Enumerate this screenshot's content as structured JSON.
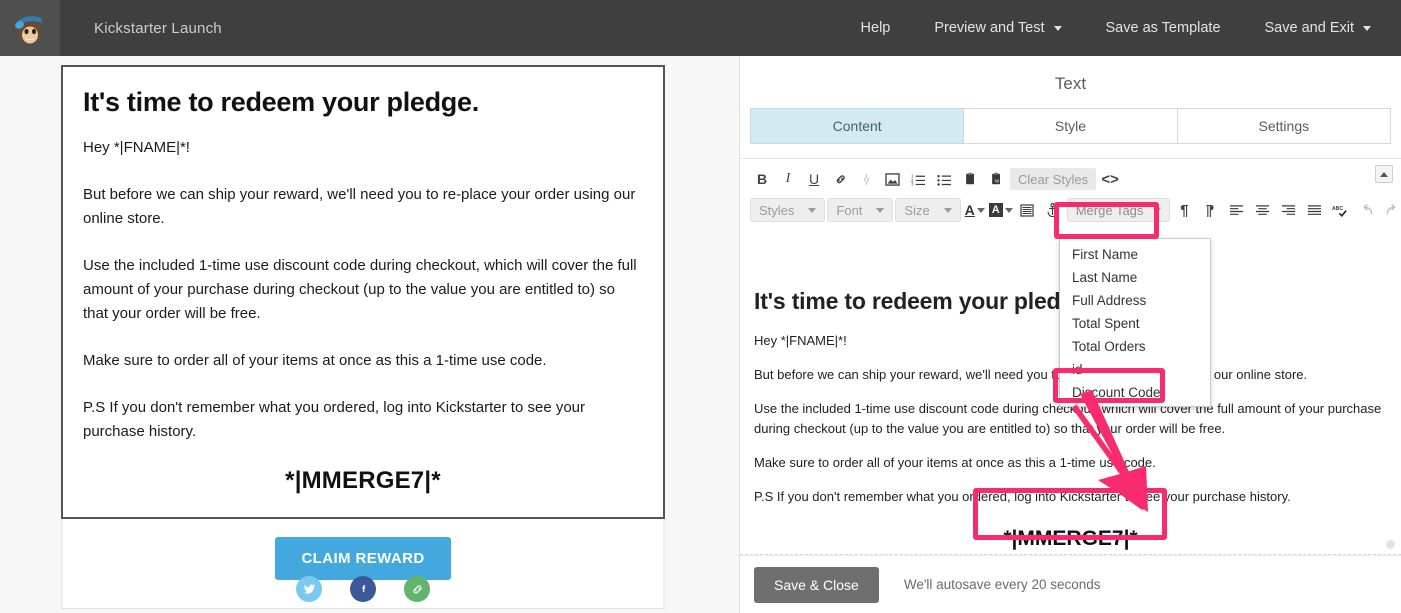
{
  "topbar": {
    "logo_icon": "mailchimp-freddie-logo",
    "campaign_title": "Kickstarter Launch",
    "nav": [
      {
        "label": "Help",
        "caret": false
      },
      {
        "label": "Preview and Test",
        "caret": true
      },
      {
        "label": "Save as Template",
        "caret": false
      },
      {
        "label": "Save and Exit",
        "caret": true
      }
    ]
  },
  "preview": {
    "heading": "It's time to redeem your pledge.",
    "paragraphs": [
      "Hey *|FNAME|*!",
      "But before we can ship your reward, we'll need you to re-place your order using our online store.",
      "Use the included 1-time use discount code during checkout, which will cover the full amount of your purchase during checkout (up to the value you are entitled to) so that your order will be free.",
      "Make sure to order all of your items at once as this a 1-time use code.",
      "P.S If you don't remember what you ordered, log into Kickstarter to see your purchase history."
    ],
    "merge_code": "*|MMERGE7|*",
    "cta_label": "CLAIM REWARD",
    "social": [
      {
        "name": "twitter-icon",
        "glyph": "🕊",
        "color": "#7bc9ee"
      },
      {
        "name": "facebook-icon",
        "glyph": "f",
        "color": "#3b5998"
      },
      {
        "name": "link-icon",
        "glyph": "🔗",
        "color": "#63b46a"
      }
    ]
  },
  "panel": {
    "title": "Text",
    "tabs": [
      {
        "label": "Content",
        "active": true
      },
      {
        "label": "Style",
        "active": false
      },
      {
        "label": "Settings",
        "active": false
      }
    ],
    "toolbar_row1": [
      {
        "name": "bold-icon",
        "glyph": "B",
        "disabled": false
      },
      {
        "name": "italic-icon",
        "glyph": "I",
        "disabled": false
      },
      {
        "name": "underline-icon",
        "glyph": "U",
        "disabled": false
      },
      {
        "name": "link-icon",
        "glyph": "⎆",
        "disabled": false
      },
      {
        "name": "unlink-icon",
        "glyph": "⎇",
        "disabled": true
      },
      {
        "name": "image-icon",
        "glyph": "ὛC",
        "disabled": false
      },
      {
        "name": "numbered-list-icon",
        "glyph": "☰",
        "disabled": false
      },
      {
        "name": "bullet-list-icon",
        "glyph": "☰",
        "disabled": false
      },
      {
        "name": "paste-icon",
        "glyph": "📋",
        "disabled": false
      },
      {
        "name": "paste-from-word-icon",
        "glyph": "📄",
        "disabled": false
      }
    ],
    "clear_styles_label": "Clear Styles",
    "code_view_label": "<>",
    "toolbar_row2_selects": [
      {
        "name": "styles-select",
        "label": "Styles"
      },
      {
        "name": "font-select",
        "label": "Font"
      },
      {
        "name": "size-select",
        "label": "Size"
      }
    ],
    "merge_tags_label": "Merge Tags",
    "toolbar_row2_icons": [
      {
        "name": "text-color-icon",
        "glyph": "A"
      },
      {
        "name": "highlight-color-icon",
        "glyph": "A"
      },
      {
        "name": "background-icon",
        "glyph": "☰"
      },
      {
        "name": "anchor-icon",
        "glyph": "⚓"
      },
      {
        "name": "paragraph-icon",
        "glyph": "¶"
      },
      {
        "name": "paragraph-rtl-icon",
        "glyph": "¶"
      },
      {
        "name": "align-left-icon",
        "glyph": "≡"
      },
      {
        "name": "align-center-icon",
        "glyph": "≡"
      },
      {
        "name": "align-right-icon",
        "glyph": "≡"
      },
      {
        "name": "align-justify-icon",
        "glyph": "≡"
      },
      {
        "name": "spellcheck-icon",
        "glyph": "✔"
      },
      {
        "name": "undo-icon",
        "glyph": "↶"
      },
      {
        "name": "redo-icon",
        "glyph": "↷"
      }
    ],
    "collapse_icon": "collapse-toolbar-icon"
  },
  "merge_menu": {
    "items": [
      {
        "label": "First Name",
        "highlighted": false
      },
      {
        "label": "Last Name",
        "highlighted": false
      },
      {
        "label": "Full Address",
        "highlighted": false
      },
      {
        "label": "Total Spent",
        "highlighted": false
      },
      {
        "label": "Total Orders",
        "highlighted": false
      },
      {
        "label": "id",
        "highlighted": false
      },
      {
        "label": "Discount Code",
        "highlighted": true
      }
    ]
  },
  "editor": {
    "heading": "It's time to redeem your pledge.",
    "paragraphs": [
      "Hey *|FNAME|*!",
      "But before we can ship your reward, we'll need you to re-place your order using our online store.",
      "Use the included 1-time use discount code during checkout, which will cover the full amount of your purchase during checkout (up to the value you are entitled to) so that your order will be free.",
      "Make sure to order all of your items at once as this a 1-time use code.",
      "P.S If you don't remember what you ordered, log into Kickstarter to see your purchase history."
    ],
    "merge_code": "*|MMERGE7|*"
  },
  "footer": {
    "save_close_label": "Save & Close",
    "autosave_text": "We'll autosave every 20 seconds"
  },
  "annotation": {
    "color": "#f72b6e"
  }
}
